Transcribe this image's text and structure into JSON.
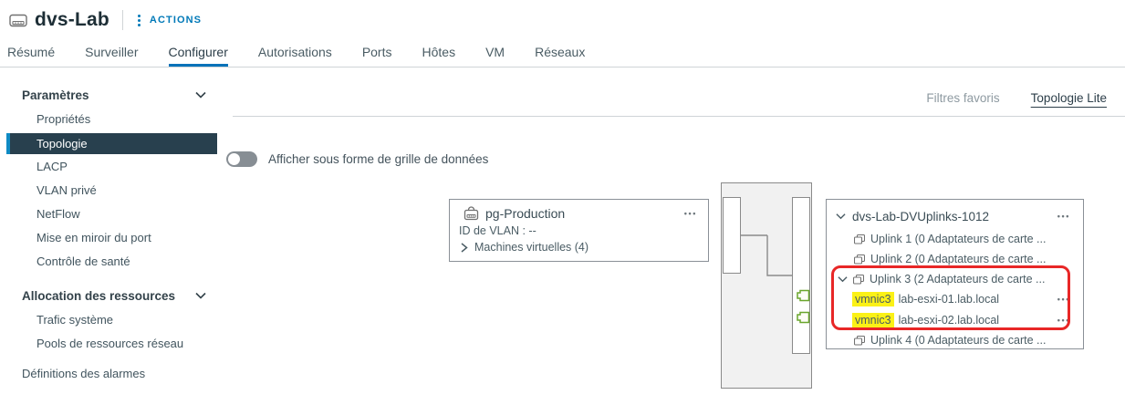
{
  "header": {
    "title": "dvs-Lab",
    "actions_label": "ACTIONS"
  },
  "tabs": [
    "Résumé",
    "Surveiller",
    "Configurer",
    "Autorisations",
    "Ports",
    "Hôtes",
    "VM",
    "Réseaux"
  ],
  "sidebar": {
    "section1": "Paramètres",
    "items1": [
      "Propriétés",
      "Topologie",
      "LACP",
      "VLAN privé",
      "NetFlow",
      "Mise en miroir du port",
      "Contrôle de santé"
    ],
    "section2": "Allocation des ressources",
    "items2": [
      "Trafic système",
      "Pools de ressources réseau"
    ],
    "alarms": "Définitions des alarmes"
  },
  "view_controls": {
    "favorite_filters": "Filtres favoris",
    "topology_lite": "Topologie Lite"
  },
  "toggle": {
    "label": "Afficher sous forme de grille de données",
    "state": "off"
  },
  "portgroup_box": {
    "title": "pg-Production",
    "vlan_row": "ID de VLAN : --",
    "vms_row": "Machines virtuelles (4)"
  },
  "uplinks_box": {
    "title": "dvs-Lab-DVUplinks-1012",
    "uplink1": "Uplink 1 (0 Adaptateurs de carte ...",
    "uplink2": "Uplink 2 (0 Adaptateurs de carte ...",
    "uplink3": "Uplink 3 (2 Adaptateurs de carte ...",
    "uplink4": "Uplink 4 (0 Adaptateurs de carte ...",
    "nic1": {
      "adapter": "vmnic3",
      "host": "lab-esxi-01.lab.local"
    },
    "nic2": {
      "adapter": "vmnic3",
      "host": "lab-esxi-02.lab.local"
    }
  },
  "icons": {
    "ellipsis": "•••"
  },
  "colors": {
    "accent_blue": "#0079b8",
    "selected_nav_bg": "#28404e",
    "highlight_yellow": "#fbf116",
    "highlight_red": "#e82727",
    "nic_green": "#6aa62c"
  }
}
